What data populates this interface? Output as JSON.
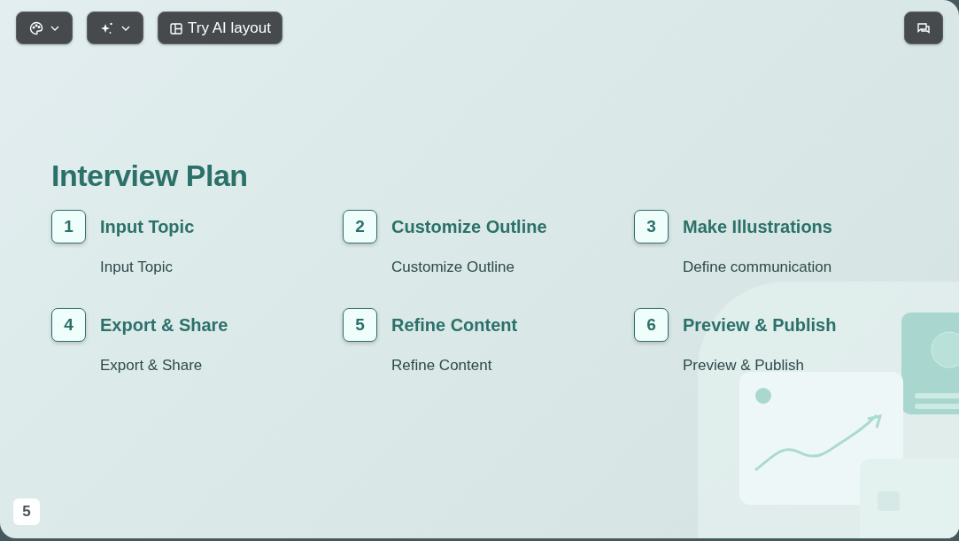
{
  "toolbar": {
    "buttons": [
      {
        "kind": "theme"
      },
      {
        "kind": "magic"
      },
      {
        "kind": "layout",
        "label": "Try AI layout"
      }
    ],
    "comments_button": {
      "kind": "comments"
    }
  },
  "slide": {
    "title": "Interview Plan",
    "steps": [
      {
        "number": "1",
        "title": "Input Topic",
        "description": "Input Topic"
      },
      {
        "number": "2",
        "title": "Customize Outline",
        "description": "Customize Outline"
      },
      {
        "number": "3",
        "title": "Make Illustrations",
        "description": "Define communication"
      },
      {
        "number": "4",
        "title": "Export & Share",
        "description": "Export & Share"
      },
      {
        "number": "5",
        "title": "Refine Content",
        "description": "Refine Content"
      },
      {
        "number": "6",
        "title": "Preview & Publish",
        "description": "Preview & Publish"
      }
    ],
    "page_number": "5"
  }
}
